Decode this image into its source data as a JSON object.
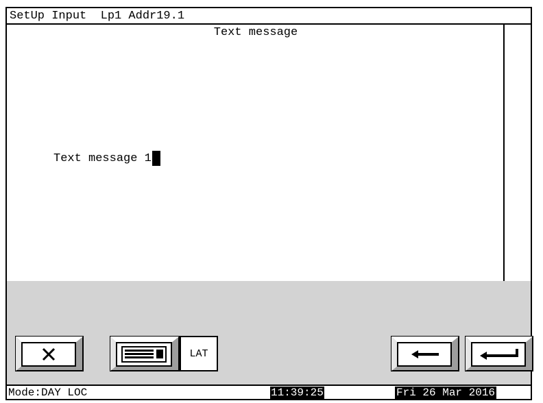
{
  "window": {
    "title": "SetUp Input  Lp1 Addr19.1"
  },
  "main": {
    "header": "Text message",
    "field_label": "Text message 1"
  },
  "toolbar": {
    "lat_label": "LAT",
    "icons": [
      "close-icon",
      "keyboard-icon",
      "back-arrow-icon",
      "enter-icon"
    ]
  },
  "status": {
    "mode": "Mode:DAY LOC",
    "time": "11:39:25",
    "date": "Fri 26 Mar 2016"
  }
}
